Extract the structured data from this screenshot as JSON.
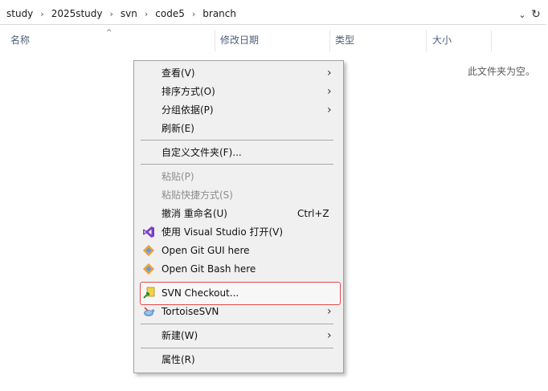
{
  "address": {
    "crumbs": [
      "study",
      "2025study",
      "svn",
      "code5",
      "branch"
    ]
  },
  "columns": {
    "name": "名称",
    "modified": "修改日期",
    "type": "类型",
    "size": "大小"
  },
  "empty_message": "此文件夹为空。",
  "menu": {
    "view": "查看(V)",
    "sort": "排序方式(O)",
    "group": "分组依据(P)",
    "refresh": "刷新(E)",
    "customize": "自定义文件夹(F)...",
    "paste": "粘贴(P)",
    "paste_shortcut": "粘贴快捷方式(S)",
    "undo_rename": "撤消 重命名(U)",
    "undo_shortcut": "Ctrl+Z",
    "open_vs": "使用 Visual Studio 打开(V)",
    "git_gui": "Open Git GUI here",
    "git_bash": "Open Git Bash here",
    "svn_checkout": "SVN Checkout...",
    "tortoise": "TortoiseSVN",
    "new": "新建(W)",
    "properties": "属性(R)"
  },
  "colors": {
    "highlight_border": "#e24b4b",
    "header_text": "#4c607a",
    "menu_bg": "#f0f0f0"
  }
}
